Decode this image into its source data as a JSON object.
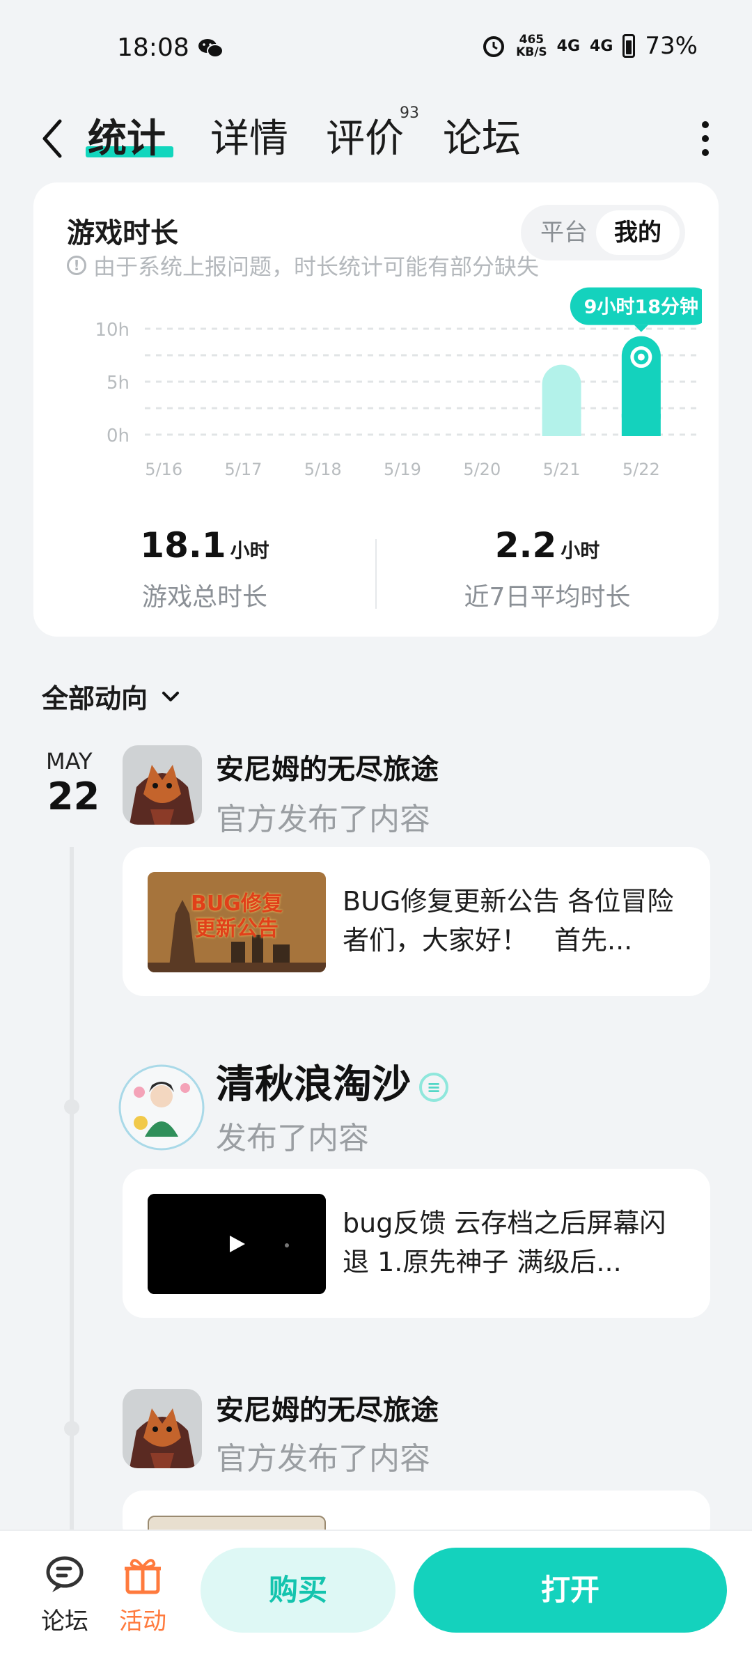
{
  "status_bar": {
    "time": "18:08",
    "speed_value": "465",
    "speed_unit": "KB/S",
    "signal1": "4G",
    "signal2": "4G",
    "battery": "73%"
  },
  "nav": {
    "tabs": [
      "统计",
      "详情",
      "评价",
      "论坛"
    ],
    "active_tab": "统计",
    "review_count": "93"
  },
  "stats_card": {
    "title": "游戏时长",
    "note": "由于系统上报问题，时长统计可能有部分缺失",
    "toggle_options": [
      "平台",
      "我的"
    ],
    "toggle_selected": "我的",
    "tooltip": "9小时18分钟",
    "total": {
      "value": "18.1",
      "unit": "小时",
      "label": "游戏总时长"
    },
    "average": {
      "value": "2.2",
      "unit": "小时",
      "label": "近7日平均时长"
    }
  },
  "chart_data": {
    "type": "bar",
    "categories": [
      "5/16",
      "5/17",
      "5/18",
      "5/19",
      "5/20",
      "5/21",
      "5/22"
    ],
    "values": [
      0,
      0,
      0,
      0,
      0,
      6.6,
      9.3
    ],
    "y_ticks": [
      "10h",
      "5h",
      "0h"
    ],
    "ylim": [
      0,
      10
    ],
    "highlight_index": 6,
    "colors": {
      "highlight": "#14d2bd",
      "normal": "#b3f2ea"
    }
  },
  "activity": {
    "filter_label": "全部动向",
    "date_month": "MAY",
    "date_day": "22",
    "posts": [
      {
        "poster": "安尼姆的无尽旅途",
        "action": "官方发布了内容",
        "thumb_title_line1": "BUG修复",
        "thumb_title_line2": "更新公告",
        "text": "BUG修复更新公告 各位冒险者们，大家好！　首先..."
      },
      {
        "poster": "清秋浪淘沙",
        "action": "发布了内容",
        "text": "bug反馈 云存档之后屏幕闪退 1.原先神子 满级后..."
      },
      {
        "poster": "安尼姆的无尽旅途",
        "action": "官方发布了内容"
      }
    ]
  },
  "bottom_bar": {
    "forum_label": "论坛",
    "activity_label": "活动",
    "buy_label": "购买",
    "open_label": "打开"
  }
}
